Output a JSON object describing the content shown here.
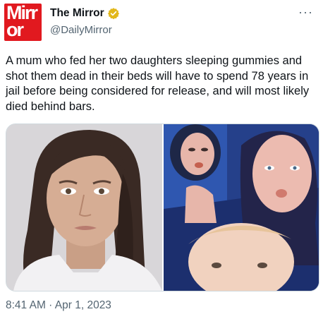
{
  "account": {
    "avatar_text_line1": "Mirr",
    "avatar_text_line2": "or",
    "display_name": "The Mirror",
    "handle": "@DailyMirror",
    "verified_color": "#e2b719"
  },
  "tweet": {
    "text": "A mum who fed her two daughters sleeping gummies and shot them dead in their beds will have to spend 78 years in jail before being considered for release, and will most likely died behind bars.",
    "timestamp": "8:41 AM · Apr 1, 2023"
  },
  "menu": {
    "more_icon": "···"
  },
  "colors": {
    "brand_red": "#e1191f",
    "secondary_text": "#536471",
    "primary_text": "#0f1419"
  }
}
